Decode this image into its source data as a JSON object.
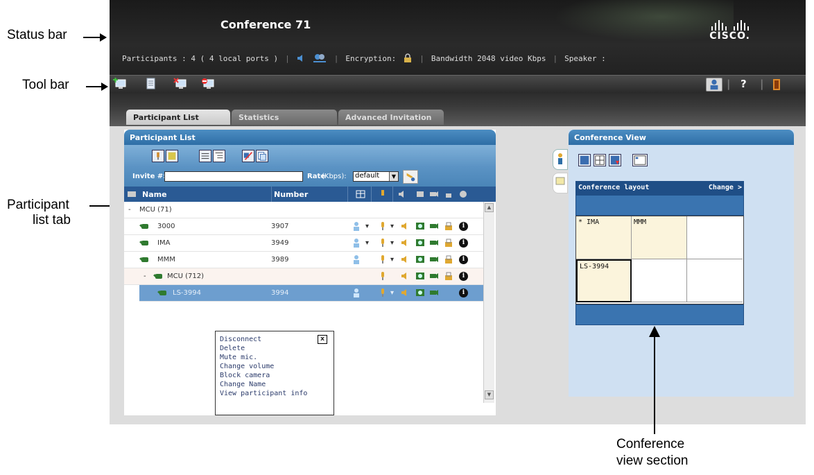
{
  "annotations": {
    "status_bar": "Status bar",
    "tool_bar": "Tool bar",
    "participant_list_tab_line1": "Participant",
    "participant_list_tab_line2": "list tab",
    "conference_view_line1": "Conference",
    "conference_view_line2": "view section",
    "figure_number": "252588"
  },
  "status": {
    "title": "Conference 71",
    "brand": "CISCO.",
    "participants": "Participants : 4 ( 4 local ports )",
    "encryption": "Encryption:",
    "bandwidth": "Bandwidth 2048 video Kbps",
    "speaker": "Speaker :"
  },
  "toolbar": {
    "left_icons": [
      "add-participant-icon",
      "document-icon",
      "delete-participant-icon",
      "disconnect-participant-icon"
    ],
    "right_icons": [
      "operator-icon",
      "help-icon",
      "exit-icon"
    ],
    "help_label": "?"
  },
  "tabs": [
    {
      "label": "Participant List",
      "active": true
    },
    {
      "label": "Statistics",
      "active": false
    },
    {
      "label": "Advanced Invitation",
      "active": false
    }
  ],
  "participant_panel": {
    "title": "Participant List",
    "invite_label": "Invite #:",
    "invite_value": "",
    "rate_label": "Rate",
    "rate_unit": "(Kbps):",
    "rate_value": "default",
    "columns": {
      "name": "Name",
      "number": "Number"
    },
    "rows": [
      {
        "name": "MCU (71)",
        "number": "",
        "type": "group"
      },
      {
        "name": "3000",
        "number": "3907",
        "type": "participant"
      },
      {
        "name": "IMA",
        "number": "3949",
        "type": "participant"
      },
      {
        "name": "MMM",
        "number": "3989",
        "type": "participant"
      },
      {
        "name": "MCU (712)",
        "number": "",
        "type": "mcu"
      },
      {
        "name": "LS-3994",
        "number": "3994",
        "type": "selected"
      }
    ],
    "group_toggle": "-",
    "sub_toggle": "-",
    "context_menu": {
      "close_label": "x",
      "items": [
        "Disconnect",
        "Delete",
        "Mute mic.",
        "Change volume",
        "Block camera",
        "Change Name",
        "View participant info"
      ]
    }
  },
  "conference_view": {
    "title": "Conference View",
    "layout_label": "Conference layout",
    "change_label": "Change >",
    "cells": [
      {
        "label": "* IMA",
        "filled": true
      },
      {
        "label": "MMM",
        "filled": true
      },
      {
        "label": "",
        "filled": false
      },
      {
        "label": "LS-3994",
        "filled": true
      },
      {
        "label": "",
        "filled": false
      },
      {
        "label": "",
        "filled": false
      }
    ]
  },
  "colors": {
    "panel_header": "#2e6ea6",
    "table_header": "#2a5a94",
    "selected_row": "#6d9ecf",
    "layout_bar": "#1f4e86",
    "cell_fill": "#fbf4dc"
  }
}
